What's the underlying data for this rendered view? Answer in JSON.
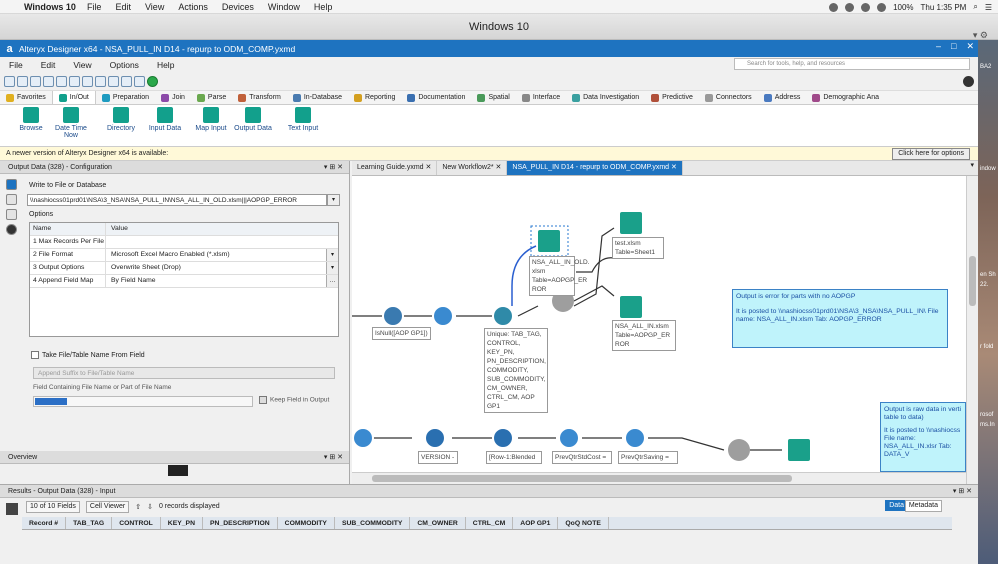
{
  "mac": {
    "apple": "",
    "app_name": "Windows 10",
    "menus": [
      "File",
      "Edit",
      "View",
      "Actions",
      "Devices",
      "Window",
      "Help"
    ],
    "battery": "100%",
    "clock": "Thu 1:35 PM"
  },
  "vm": {
    "title": "Windows 10"
  },
  "desktop_labels": [
    "BA2",
    "indow",
    "en Sh",
    "22.",
    "r fold",
    "rosof",
    "ms.In"
  ],
  "app": {
    "title": "Alteryx Designer x64 - NSA_PULL_IN D14 - repurp to ODM_COMP.yxmd",
    "menus": [
      "File",
      "Edit",
      "View",
      "Options",
      "Help"
    ],
    "search_placeholder": "Search for tools, help, and resources",
    "categories": [
      {
        "label": "Favorites",
        "color": "#e0b020"
      },
      {
        "label": "In/Out",
        "color": "#12a08c"
      },
      {
        "label": "Preparation",
        "color": "#1e9bc0"
      },
      {
        "label": "Join",
        "color": "#8b4aa8"
      },
      {
        "label": "Parse",
        "color": "#6aa84f"
      },
      {
        "label": "Transform",
        "color": "#c0603a"
      },
      {
        "label": "In-Database",
        "color": "#4a7bb0"
      },
      {
        "label": "Reporting",
        "color": "#d4a020"
      },
      {
        "label": "Documentation",
        "color": "#3a6fb0"
      },
      {
        "label": "Spatial",
        "color": "#4a9a5a"
      },
      {
        "label": "Interface",
        "color": "#888888"
      },
      {
        "label": "Data Investigation",
        "color": "#3aa0a0"
      },
      {
        "label": "Predictive",
        "color": "#b0503a"
      },
      {
        "label": "Connectors",
        "color": "#999999"
      },
      {
        "label": "Address",
        "color": "#4a7ac0"
      },
      {
        "label": "Demographic Ana",
        "color": "#a04a8a"
      }
    ],
    "palette_tools": [
      "Browse",
      "Date Time Now",
      "Directory",
      "Input Data",
      "Map Input",
      "Output Data",
      "Text Input"
    ],
    "notice": "A newer version of Alteryx Designer x64 is available:",
    "notice_button": "Click here for options"
  },
  "config": {
    "header": "Output Data (328) - Configuration",
    "write_label": "Write to File or Database",
    "path": "\\\\nashiocss01prd01\\NSA\\3_NSA\\NSA_PULL_IN\\NSA_ALL_IN_OLD.xlsm|||AOPGP_ERROR",
    "options_label": "Options",
    "col_name": "Name",
    "col_value": "Value",
    "rows": [
      {
        "name": "1  Max Records Per File",
        "value": ""
      },
      {
        "name": "2  File Format",
        "value": "Microsoft Excel Macro Enabled (*.xlsm)"
      },
      {
        "name": "3  Output Options",
        "value": "Overwrite Sheet (Drop)"
      },
      {
        "name": "4  Append Field Map",
        "value": "By Field Name"
      }
    ],
    "take_from_field": "Take File/Table Name From Field",
    "append_suffix": "Append Suffix to File/Table Name",
    "field_containing": "Field Containing File Name or Part of File Name",
    "keep_field": "Keep Field in Output"
  },
  "overview": {
    "header": "Overview"
  },
  "tabs": [
    {
      "label": "Learning Guide.yxmd",
      "active": false
    },
    {
      "label": "New Workflow2*",
      "active": false
    },
    {
      "label": "NSA_PULL_IN D14 - repurp to ODM_COMP.yxmd",
      "active": true
    }
  ],
  "canvas": {
    "isnull_label": "IsNull([AOP GP1])",
    "unique_label": "Unique: TAB_TAG, CONTROL, KEY_PN, PN_DESCRIPTION, COMMODITY, SUB_COMMODITY, CM_OWNER, CTRL_CM, AOP GP1",
    "out1_label": "NSA_ALL_IN_OLD. xlsm Table=AOPGP_ER ROR",
    "out2_label": "test.xlsm Table=Sheet1",
    "out3_label": "NSA_ALL_IN.xlsm Table=AOPGP_ER ROR",
    "box1_title": "Output is error for parts with no AOPGP",
    "box1_body": "It is posted to \\\\nashiocss01prd01\\NSA\\3_NSA\\NSA_PULL_IN\\ File name: NSA_ALL_IN.xlsm Tab: AOPGP_ERROR",
    "box2_title": "Output is raw data in verti table to data)",
    "box2_body": "It is posted to \\\\nashiocss File name: NSA_ALL_IN.xlsr Tab: DATA_V",
    "lower_labels": [
      "VERSION -",
      "[Row-1:Blended",
      "PrevQtrStdCost =",
      "PrevQtrSaving ="
    ]
  },
  "results": {
    "header": "Results - Output Data (328) - Input",
    "fields": "10 of 10 Fields",
    "viewer": "Cell Viewer",
    "records": "0 records displayed",
    "data_tab": "Data",
    "meta_tab": "Metadata",
    "columns": [
      "Record #",
      "TAB_TAG",
      "CONTROL",
      "KEY_PN",
      "PN_DESCRIPTION",
      "COMMODITY",
      "SUB_COMMODITY",
      "CM_OWNER",
      "CTRL_CM",
      "AOP GP1",
      "QoQ NOTE"
    ]
  }
}
